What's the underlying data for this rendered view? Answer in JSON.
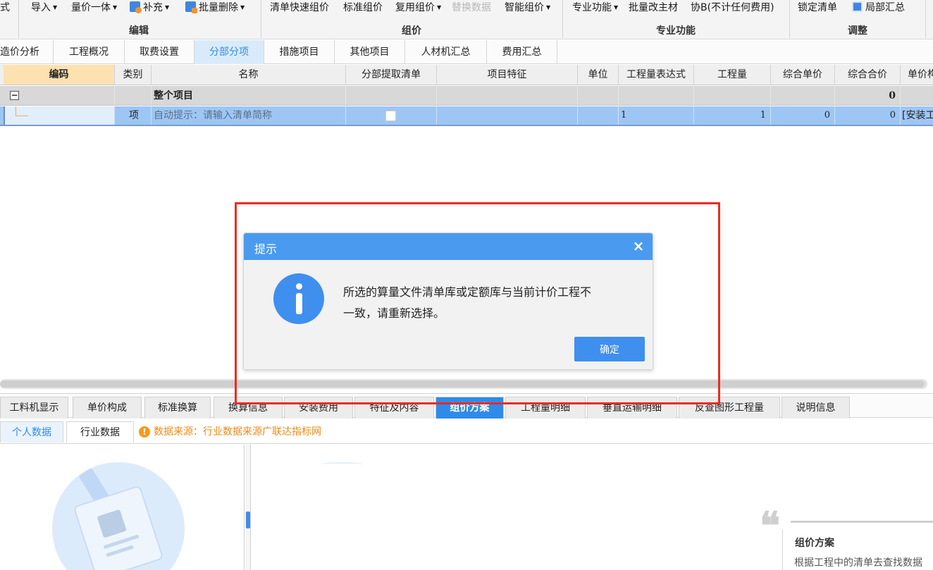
{
  "ribbon": {
    "tools": [
      {
        "label": "式"
      },
      {
        "label": "导入"
      },
      {
        "label": "量价一体"
      },
      {
        "label": "补充"
      },
      {
        "label": "批量删除"
      },
      {
        "label": "清单快速组价"
      },
      {
        "label": "标准组价"
      },
      {
        "label": "复用组价"
      },
      {
        "label": "替换数据"
      },
      {
        "label": "智能组价"
      },
      {
        "label": "专业功能"
      },
      {
        "label": "批量改主材"
      },
      {
        "label": "协B(不计任何费用)"
      },
      {
        "label": "锁定清单"
      },
      {
        "label": "局部汇总"
      }
    ],
    "groups": [
      "编辑",
      "组价",
      "专业功能",
      "调整"
    ]
  },
  "tabs": [
    "造价分析",
    "工程概况",
    "取费设置",
    "分部分项",
    "措施项目",
    "其他项目",
    "人材机汇总",
    "费用汇总"
  ],
  "table": {
    "headers": [
      "编码",
      "类别",
      "名称",
      "分部提取清单",
      "项目特征",
      "单位",
      "工程量表达式",
      "工程量",
      "综合单价",
      "综合合价",
      "单价构"
    ],
    "rows": [
      {
        "code": "",
        "type": "",
        "name": "整个项目",
        "total": "0"
      },
      {
        "code": "",
        "type": "项",
        "name": "自动提示：请输入清单简称",
        "expr": "1",
        "qty": "1",
        "unit_price": "0",
        "total": "0",
        "price_struct": "[安装工"
      }
    ]
  },
  "bottom_tabs": [
    "工料机显示",
    "单价构成",
    "标准换算",
    "换算信息",
    "安装费用",
    "特征及内容",
    "组价方案",
    "工程量明细",
    "垂直运输明细",
    "反查图形工程量",
    "说明信息"
  ],
  "sub_tabs": [
    "个人数据",
    "行业数据"
  ],
  "source_note": "数据来源：行业数据来源广联达指标网",
  "info_panel": {
    "quote_mark": "❝",
    "title": "组价方案",
    "text": "根据工程中的清单去查找数据"
  },
  "dialog": {
    "title": "提示",
    "close": "×",
    "message_line1": "所选的算量文件清单库或定额库与当前计价工程不",
    "message_line2": "一致，请重新选择。",
    "ok_label": "确定"
  },
  "colors": {
    "accent": "#4a9bf0",
    "highlight_border": "#ee2b22",
    "selected_row": "#9ec6f5",
    "active_header": "#fde1b0"
  }
}
